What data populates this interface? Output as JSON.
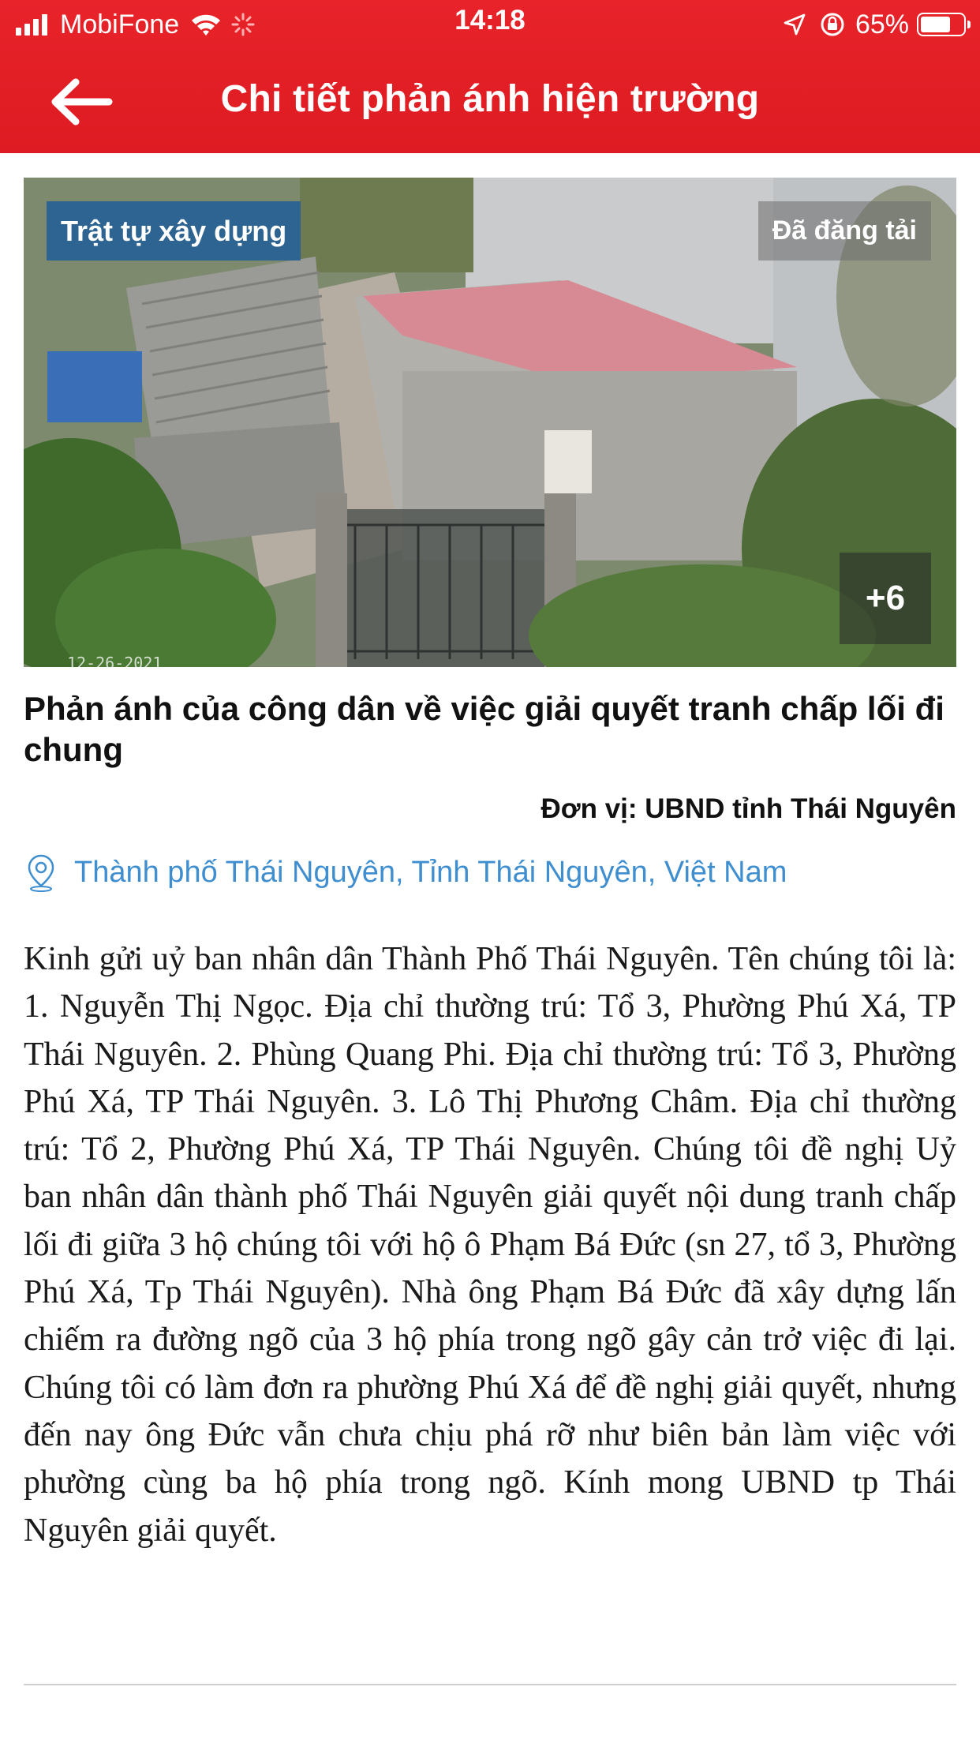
{
  "status_bar": {
    "carrier": "MobiFone",
    "time": "14:18",
    "battery": "65%",
    "battery_level": 0.65,
    "icons": [
      "signal-icon",
      "wifi-icon",
      "activity-spinner-icon",
      "location-arrow-icon",
      "rotation-lock-icon",
      "battery-icon"
    ]
  },
  "header": {
    "title": "Chi tiết phản ánh hiện trường",
    "back_icon": "arrow-left-icon",
    "background": "#e3202a"
  },
  "photo": {
    "category_badge": "Trật tự xây dựng",
    "status_badge": "Đã đăng tải",
    "more_images": "+6",
    "camera_timestamp": "12-26-2021"
  },
  "report": {
    "title": "Phản ánh của công dân về việc giải quyết tranh chấp lối đi chung",
    "unit": "Đơn vị: UBND tỉnh Thái Nguyên",
    "location": "Thành phố Thái Nguyên, Tỉnh Thái Nguyên, Việt Nam",
    "location_icon": "map-pin-icon",
    "content": "Kinh gửi uỷ ban nhân dân Thành Phố Thái Nguyên. Tên chúng tôi là: 1. Nguyễn Thị Ngọc. Địa chỉ thường trú: Tổ 3, Phường Phú Xá, TP Thái Nguyên. 2. Phùng Quang Phi. Địa chỉ thường trú: Tổ 3, Phường Phú Xá, TP Thái Nguyên. 3. Lô Thị Phương Châm. Địa chỉ thường trú: Tổ 2, Phường Phú Xá, TP Thái Nguyên. Chúng tôi đề nghị Uỷ ban nhân dân thành phố Thái Nguyên giải quyết nội dung tranh chấp lối đi giữa 3 hộ chúng tôi với hộ ô Phạm Bá Đức (sn 27, tổ 3, Phường Phú Xá, Tp Thái Nguyên). Nhà ông Phạm Bá Đức đã xây dựng lấn chiếm ra đường ngõ của 3 hộ phía trong ngõ gây cản trở việc đi lại. Chúng tôi có làm đơn ra phường Phú Xá để đề nghị giải quyết, nhưng đến nay ông Đức vẫn chưa chịu phá rỡ như biên bản làm việc với phường cùng ba hộ phía trong ngõ. Kính mong UBND tp Thái Nguyên giải quyết.",
    "accent_color": "#3f8ed0",
    "category_color": "#235f96"
  }
}
